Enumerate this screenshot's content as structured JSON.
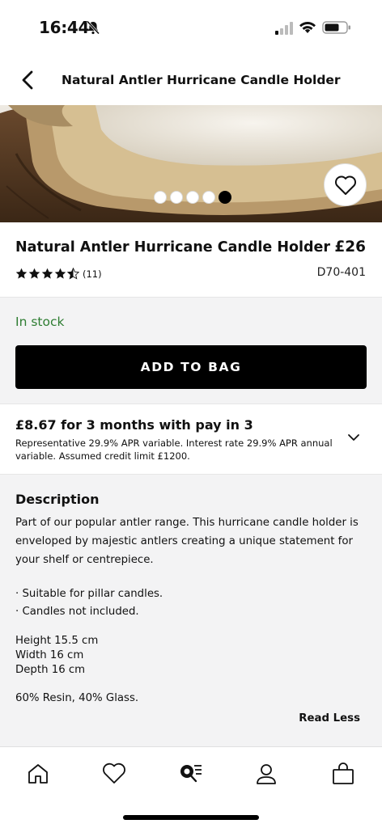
{
  "status_bar": {
    "time": "16:44"
  },
  "nav": {
    "title": "Natural Antler Hurricane Candle Holder"
  },
  "gallery": {
    "image_count": 5,
    "active_index": 4
  },
  "product": {
    "name": "Natural Antler Hurricane Candle Holder",
    "price": "£26",
    "rating": 4.5,
    "review_count": "(11)",
    "sku": "D70-401"
  },
  "availability": {
    "stock_label": "In stock",
    "add_to_bag_label": "ADD TO BAG"
  },
  "pay_in_3": {
    "title": "£8.67 for 3 months with pay in 3",
    "description": "Representative 29.9% APR variable. Interest rate 29.9% APR annual variable. Assumed credit limit £1200."
  },
  "description": {
    "heading": "Description",
    "body": "Part of our popular antler range. This hurricane candle holder is enveloped by majestic antlers creating a unique statement for your shelf or centrepiece.",
    "bullets": [
      "· Suitable for pillar candles.",
      "· Candles not included."
    ],
    "dimensions": [
      "Height 15.5 cm",
      "Width 16 cm",
      "Depth 16 cm"
    ],
    "material": "60% Resin, 40% Glass.",
    "toggle_label": "Read Less"
  },
  "tab_bar": {
    "icons": [
      "home-icon",
      "heart-icon",
      "search-list-icon",
      "account-icon",
      "bag-icon"
    ]
  },
  "colors": {
    "accent": "#000000",
    "in_stock": "#2e7d32",
    "section_bg": "#f3f3f4"
  }
}
